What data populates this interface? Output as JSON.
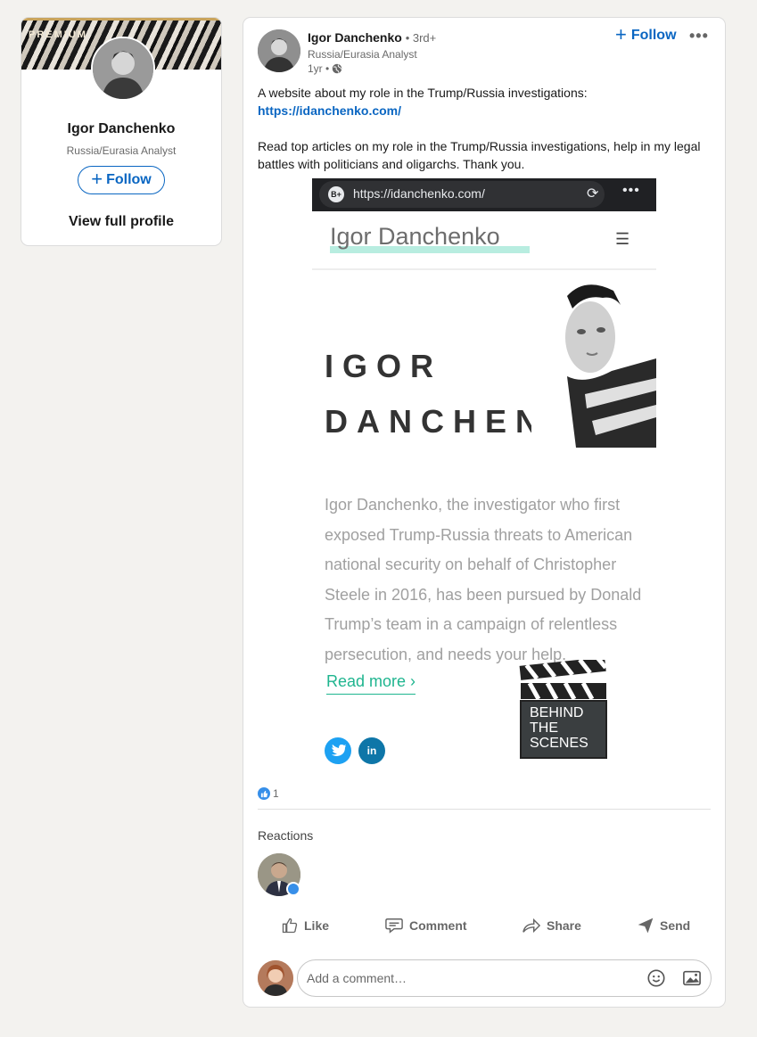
{
  "profile_card": {
    "badge": "PREMIUM",
    "name": "Igor Danchenko",
    "headline": "Russia/Eurasia Analyst",
    "follow_label": "Follow",
    "view_profile_label": "View full profile"
  },
  "post": {
    "author": {
      "name": "Igor Danchenko",
      "degree": "• 3rd+",
      "headline": "Russia/Eurasia Analyst",
      "time": "1yr •"
    },
    "follow_label": "Follow",
    "more_label": "•••",
    "text_line1": "A website about my role in the Trump/Russia investigations:",
    "link": "https://idanchenko.com/",
    "text_paragraph2": "Read top articles on my role in the Trump/Russia investigations, help in my legal battles with politicians and oligarchs. Thank you.",
    "image": {
      "url_icon": "B+",
      "url": "https://idanchenko.com/",
      "site_title": "Igor Danchenko",
      "heading_line1": "IGOR",
      "heading_line2": "DANCHENKO",
      "blurb": "Igor Danchenko, the investigator who first exposed Trump-Russia threats to American national security on behalf of Christopher Steele in 2016, has been pursued by Donald Trump’s team in a campaign of relentless persecution, and needs your help.",
      "read_more": "Read more ›",
      "clapper_text": [
        "BEHIND",
        "THE",
        "SCENES"
      ],
      "linkedin_icon_text": "in"
    },
    "reaction_count": "1",
    "reactions_label": "Reactions",
    "actions": {
      "like": "Like",
      "comment": "Comment",
      "share": "Share",
      "send": "Send"
    },
    "comment_placeholder": "Add a comment…"
  },
  "colors": {
    "brand_blue": "#0a66c2",
    "like_blue": "#378fe9",
    "page_bg": "#f3f2ef",
    "accent_teal": "#1fb58f"
  }
}
